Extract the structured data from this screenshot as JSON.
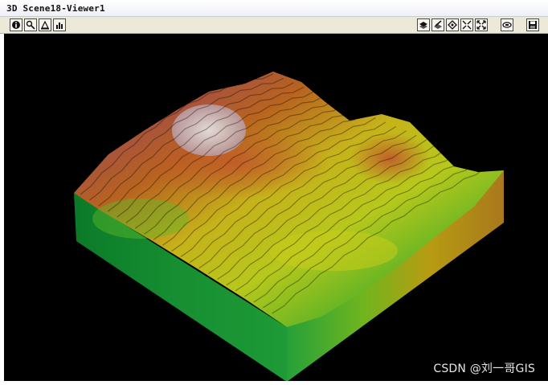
{
  "window": {
    "title": "3D Scene18-Viewer1"
  },
  "toolbar": {
    "left_buttons": [
      {
        "name": "info-icon"
      },
      {
        "name": "zoom-icon"
      },
      {
        "name": "pan-icon"
      },
      {
        "name": "fly-icon"
      }
    ],
    "right_buttons": [
      {
        "name": "view-layer-icon"
      },
      {
        "name": "view-edit-icon"
      },
      {
        "name": "navigate-icon"
      },
      {
        "name": "zoom-in-out-icon"
      },
      {
        "name": "full-extent-icon"
      },
      {
        "name": "rotate-icon"
      },
      {
        "name": "save-icon"
      }
    ]
  },
  "scene": {
    "background": "#000000",
    "colors": {
      "low": "#1ea83a",
      "mid": "#c8d81a",
      "high": "#b83a22",
      "peak": "#d9d9d9"
    }
  },
  "watermark": {
    "text": "CSDN @刘一哥GIS"
  }
}
